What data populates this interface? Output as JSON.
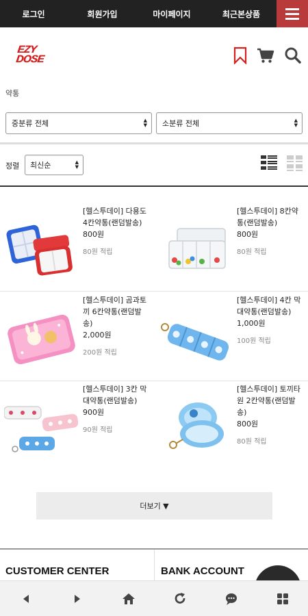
{
  "topnav": {
    "login": "로그인",
    "join": "회원가입",
    "mypage": "마이페이지",
    "recent": "최근본상품"
  },
  "header": {
    "logo_line1": "EZY",
    "logo_line2": "DOSE"
  },
  "breadcrumb": "약통",
  "filters": {
    "middle_category": "중분류 전체",
    "small_category": "소분류 전체"
  },
  "sort": {
    "label": "정렬",
    "selected": "최신순"
  },
  "products": [
    {
      "name": "[헬스투데이] 다용도 4칸약통(랜덤발송)",
      "price": "800원",
      "point": "80원 적립"
    },
    {
      "name": "[헬스투데이] 8칸약통(랜덤발송)",
      "price": "800원",
      "point": "80원 적립"
    },
    {
      "name": "[헬스투데이] 곰과토끼 6칸약통(랜덤발송)",
      "price": "2,000원",
      "point": "200원 적립"
    },
    {
      "name": "[헬스투데이] 4칸 막대약통(랜덤발송)",
      "price": "1,000원",
      "point": "100원 적립"
    },
    {
      "name": "[헬스투데이] 3칸 막대약통(랜덤발송)",
      "price": "900원",
      "point": "90원 적립"
    },
    {
      "name": "[헬스투데이] 토끼타원 2칸약통(랜덤발송)",
      "price": "800원",
      "point": "80원 적립"
    }
  ],
  "more_button": "더보기 ▼",
  "footer": {
    "customer_center": "CUSTOMER CENTER",
    "bank_account": "BANK ACCOUNT"
  },
  "colors": {
    "accent_red": "#b83a3a",
    "logo_red": "#d62020",
    "nav_bg": "#222222"
  }
}
